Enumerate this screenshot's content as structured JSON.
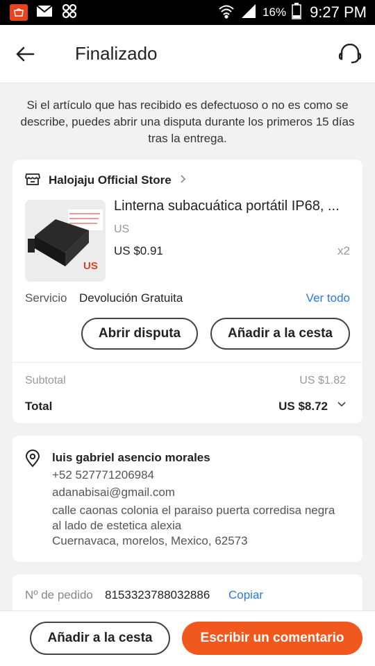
{
  "status_bar": {
    "battery": "16%",
    "time": "9:27 PM"
  },
  "header": {
    "title": "Finalizado"
  },
  "notice": "Si el artículo que has recibido es defectuoso o no es como se describe, puedes abrir una disputa durante los primeros 15 días tras la entrega.",
  "store": {
    "name": "Halojaju Official Store"
  },
  "product": {
    "title": "Linterna subacuática portátil IP68, ...",
    "variant": "US",
    "price": "US $0.91",
    "quantity": "x2",
    "thumb_badge": "US"
  },
  "service": {
    "label": "Servicio",
    "value": "Devolución Gratuita",
    "link": "Ver todo"
  },
  "actions": {
    "dispute": "Abrir disputa",
    "add_to_cart": "Añadir a la cesta"
  },
  "totals": {
    "subtotal_label": "Subtotal",
    "subtotal_value": "US $1.82",
    "total_label": "Total",
    "total_value": "US $8.72"
  },
  "address": {
    "name": "luis gabriel asencio morales",
    "phone": "+52 527771206984",
    "email": "adanabisai@gmail.com",
    "street": "calle caonas colonia el paraiso     puerta corredisa negra al lado de estetica alexia",
    "city": "Cuernavaca, morelos, Mexico, 62573"
  },
  "order": {
    "label": "Nº de pedido",
    "number": "8153323788032886",
    "copy": "Copiar"
  },
  "bottom": {
    "add_to_cart": "Añadir a la cesta",
    "review": "Escribir un comentario"
  },
  "colors": {
    "accent": "#f0581d",
    "link": "#2a7ae2"
  }
}
